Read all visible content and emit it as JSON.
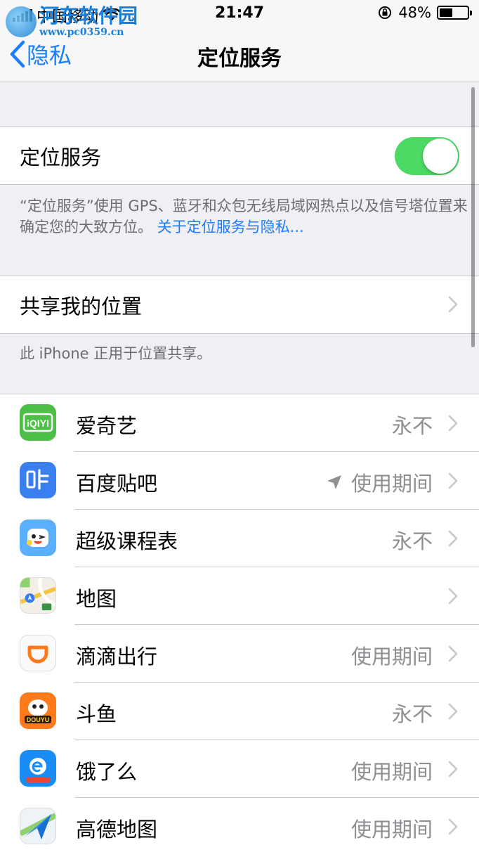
{
  "status": {
    "carrier": "中国移动",
    "time": "21:47",
    "battery_text": "48%",
    "battery_level": 0.48
  },
  "watermark": {
    "title": "河东软件园",
    "url": "www.pc0359.cn"
  },
  "nav": {
    "back_label": "隐私",
    "title": "定位服务"
  },
  "location_toggle": {
    "label": "定位服务",
    "on": true
  },
  "location_footer": {
    "text": "“定位服务”使用 GPS、蓝牙和众包无线局域网热点以及信号塔位置来确定您的大致方位。",
    "link": "关于定位服务与隐私..."
  },
  "share": {
    "label": "共享我的位置",
    "footer": "此 iPhone 正用于位置共享。"
  },
  "apps": [
    {
      "name": "爱奇艺",
      "value": "永不",
      "icon": "iqiyi-icon"
    },
    {
      "name": "百度贴吧",
      "value": "使用期间",
      "icon": "tieba-icon",
      "location_arrow": true
    },
    {
      "name": "超级课程表",
      "value": "永不",
      "icon": "course-table-icon"
    },
    {
      "name": "地图",
      "value": "",
      "icon": "maps-icon"
    },
    {
      "name": "滴滴出行",
      "value": "使用期间",
      "icon": "didi-icon"
    },
    {
      "name": "斗鱼",
      "value": "永不",
      "icon": "douyu-icon"
    },
    {
      "name": "饿了么",
      "value": "使用期间",
      "icon": "eleme-icon"
    },
    {
      "name": "高德地图",
      "value": "使用期间",
      "icon": "amap-icon"
    }
  ],
  "colors": {
    "accent": "#1a7dfb",
    "toggle_on": "#4cd964",
    "secondary_text": "#8e8e93"
  }
}
